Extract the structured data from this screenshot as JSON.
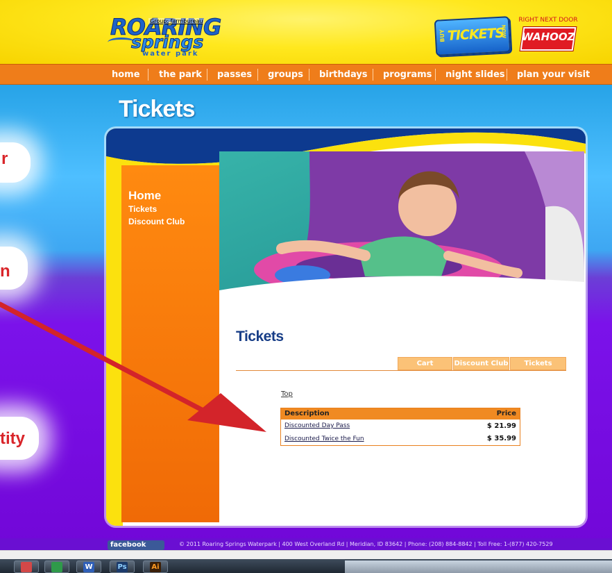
{
  "header": {
    "logo_line1": "ROARING",
    "logo_line2": "springs",
    "logo_line3": "water park",
    "logo_tag": "Group: farmbureau",
    "buy": {
      "small": "BUY",
      "big": "TICKETS",
      "now": "NOW"
    },
    "wahooz": {
      "tagline": "RIGHT NEXT DOOR",
      "name": "WAHOOZ"
    }
  },
  "nav": [
    "home",
    "the park",
    "passes",
    "groups",
    "birthdays",
    "programs",
    "night slides",
    "plan your visit"
  ],
  "callouts": [
    "r",
    "n",
    "tity"
  ],
  "page_title": "Tickets",
  "side_menu": [
    "Home",
    "Tickets",
    "Discount Club"
  ],
  "content": {
    "title": "Tickets",
    "tabs": [
      "Cart",
      "Discount Club",
      "Tickets"
    ],
    "top_link": "Top",
    "table": {
      "headers": [
        "Description",
        "Price"
      ],
      "rows": [
        {
          "description": "Discounted Day Pass",
          "price": "$ 21.99"
        },
        {
          "description": "Discounted Twice the Fun",
          "price": "$ 35.99"
        }
      ]
    }
  },
  "footer": {
    "facebook": "facebook",
    "copyright": "© 2011 Roaring Springs Waterpark  |  400 West Overland Rd  |  Meridian, ID 83642  |  Phone: (208) 884-8842  |  Toll Free: 1-(877) 420-7529"
  },
  "taskbar": [
    "W",
    "Ps",
    "Ai"
  ],
  "colors": {
    "nav": "#ef7d1a",
    "sidebar": "#f37a0f",
    "title_blue": "#173d87",
    "arrow": "#d3242a"
  }
}
